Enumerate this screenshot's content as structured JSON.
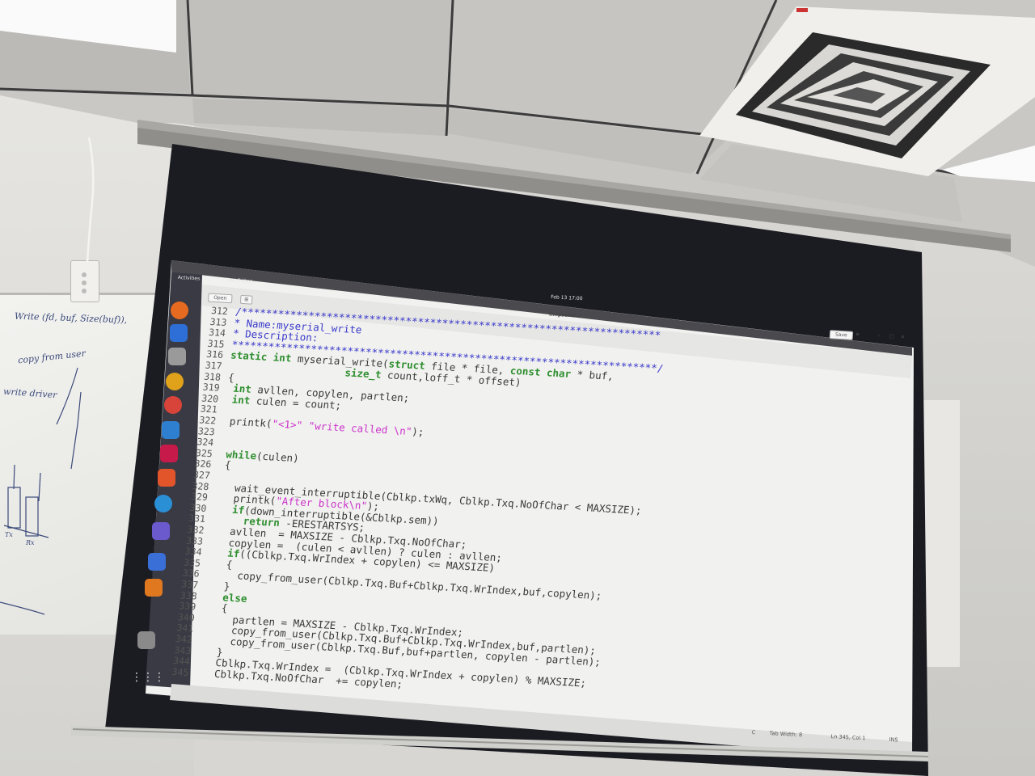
{
  "whiteboard": {
    "line1": "Write (fd, buf, Size(buf)),",
    "line2": "copy from user",
    "line3": "write driver",
    "label_tx": "Tx",
    "label_rx": "Rx"
  },
  "projection": {
    "topbar": {
      "activities": "Activities",
      "app": "Text Editor",
      "clock": "Feb 13  17:00"
    },
    "editor": {
      "open_label": "Open",
      "filename": "timpserial.c",
      "save_label": "Save"
    },
    "code_lines": [
      {
        "n": "312",
        "segs": [
          [
            "cm",
            "/*********************************************************************"
          ]
        ]
      },
      {
        "n": "313",
        "segs": [
          [
            "cm",
            "* Name:myserial_write"
          ]
        ]
      },
      {
        "n": "314",
        "segs": [
          [
            "cm",
            "* Description:"
          ]
        ]
      },
      {
        "n": "315",
        "segs": [
          [
            "cm",
            "**********************************************************************/"
          ]
        ]
      },
      {
        "n": "316",
        "segs": [
          [
            "kw",
            "static"
          ],
          [
            "pl",
            " "
          ],
          [
            "ty",
            "int"
          ],
          [
            "pl",
            " myserial_write("
          ],
          [
            "kw",
            "struct"
          ],
          [
            "pl",
            " file * file, "
          ],
          [
            "kw",
            "const"
          ],
          [
            "pl",
            " "
          ],
          [
            "ty",
            "char"
          ],
          [
            "pl",
            " * buf,"
          ]
        ]
      },
      {
        "n": "317",
        "segs": [
          [
            "pl",
            "                   "
          ],
          [
            "ty",
            "size_t"
          ],
          [
            "pl",
            " count,loff_t * offset)"
          ]
        ]
      },
      {
        "n": "318",
        "segs": [
          [
            "pl",
            "{"
          ]
        ]
      },
      {
        "n": "319",
        "segs": [
          [
            "pl",
            " "
          ],
          [
            "ty",
            "int"
          ],
          [
            "pl",
            " avllen, copylen, partlen;"
          ]
        ]
      },
      {
        "n": "320",
        "segs": [
          [
            "pl",
            " "
          ],
          [
            "ty",
            "int"
          ],
          [
            "pl",
            " culen = count;"
          ]
        ]
      },
      {
        "n": "321",
        "segs": [
          [
            "pl",
            ""
          ]
        ]
      },
      {
        "n": "322",
        "segs": [
          [
            "pl",
            " printk("
          ],
          [
            "st",
            "\"<1>\""
          ],
          [
            "pl",
            " "
          ],
          [
            "st",
            "\"write called \\n\""
          ],
          [
            "pl",
            ");"
          ]
        ]
      },
      {
        "n": "323",
        "segs": [
          [
            "pl",
            ""
          ]
        ]
      },
      {
        "n": "324",
        "segs": [
          [
            "pl",
            ""
          ]
        ]
      },
      {
        "n": "325",
        "segs": [
          [
            "pl",
            " "
          ],
          [
            "kw",
            "while"
          ],
          [
            "pl",
            "(culen)"
          ]
        ]
      },
      {
        "n": "326",
        "segs": [
          [
            "pl",
            " {"
          ]
        ]
      },
      {
        "n": "327",
        "segs": [
          [
            "pl",
            ""
          ]
        ]
      },
      {
        "n": "328",
        "segs": [
          [
            "pl",
            "   wait_event_interruptible(Cblkp.txWq, Cblkp.Txq.NoOfChar < MAXSIZE);"
          ]
        ]
      },
      {
        "n": "329",
        "segs": [
          [
            "pl",
            "   printk("
          ],
          [
            "st",
            "\"After block\\n\""
          ],
          [
            "pl",
            ");"
          ]
        ]
      },
      {
        "n": "330",
        "segs": [
          [
            "pl",
            "   "
          ],
          [
            "kw",
            "if"
          ],
          [
            "pl",
            "(down_interruptible(&Cblkp.sem))"
          ]
        ]
      },
      {
        "n": "331",
        "segs": [
          [
            "pl",
            "     "
          ],
          [
            "kw",
            "return"
          ],
          [
            "pl",
            " -ERESTARTSYS;"
          ]
        ]
      },
      {
        "n": "332",
        "segs": [
          [
            "pl",
            "   avllen  = MAXSIZE - Cblkp.Txq.NoOfChar;"
          ]
        ]
      },
      {
        "n": "333",
        "segs": [
          [
            "pl",
            "   copylen =  (culen < avllen) ? culen : avllen;"
          ]
        ]
      },
      {
        "n": "334",
        "segs": [
          [
            "pl",
            "   "
          ],
          [
            "kw",
            "if"
          ],
          [
            "pl",
            "((Cblkp.Txq.WrIndex + copylen) <= MAXSIZE)"
          ]
        ]
      },
      {
        "n": "335",
        "segs": [
          [
            "pl",
            "   {"
          ]
        ]
      },
      {
        "n": "336",
        "segs": [
          [
            "pl",
            "     copy_from_user(Cblkp.Txq.Buf+Cblkp.Txq.WrIndex,buf,copylen);"
          ]
        ]
      },
      {
        "n": "337",
        "segs": [
          [
            "pl",
            "   }"
          ]
        ]
      },
      {
        "n": "338",
        "segs": [
          [
            "pl",
            "   "
          ],
          [
            "kw",
            "else"
          ]
        ]
      },
      {
        "n": "339",
        "segs": [
          [
            "pl",
            "   {"
          ]
        ]
      },
      {
        "n": "340",
        "segs": [
          [
            "pl",
            "     partlen = MAXSIZE - Cblkp.Txq.WrIndex;"
          ]
        ]
      },
      {
        "n": "341",
        "segs": [
          [
            "pl",
            "     copy_from_user(Cblkp.Txq.Buf+Cblkp.Txq.WrIndex,buf,partlen);"
          ]
        ]
      },
      {
        "n": "342",
        "segs": [
          [
            "pl",
            "     copy_from_user(Cblkp.Txq.Buf,buf+partlen, copylen - partlen);"
          ]
        ]
      },
      {
        "n": "343",
        "segs": [
          [
            "pl",
            "   }"
          ]
        ]
      },
      {
        "n": "344",
        "segs": [
          [
            "pl",
            "   Cblkp.Txq.WrIndex =  (Cblkp.Txq.WrIndex + copylen) % MAXSIZE;"
          ]
        ]
      },
      {
        "n": "345",
        "segs": [
          [
            "pl",
            "   Cblkp.Txq.NoOfChar  += copylen;"
          ]
        ]
      }
    ],
    "statusbar": {
      "lang": "C",
      "tab_width": "Tab Width: 8",
      "position": "Ln 345, Col 1",
      "mode": "INS"
    }
  },
  "colors": {
    "keyword": "#2f8f2f",
    "comment": "#3a3acc",
    "string": "#cc33cc",
    "editor_bg": "#f4f4f4",
    "screen_frame": "#1b1c22"
  },
  "dock_icons": [
    "firefox-icon",
    "thunderbird-icon",
    "files-icon",
    "rhythmbox-icon",
    "chrome-icon",
    "libreoffice-writer-icon",
    "raspberry-icon",
    "software-center-icon",
    "help-icon",
    "teams-icon",
    "text-editor-icon",
    "app-icon",
    "trash-icon",
    "show-apps-icon"
  ]
}
